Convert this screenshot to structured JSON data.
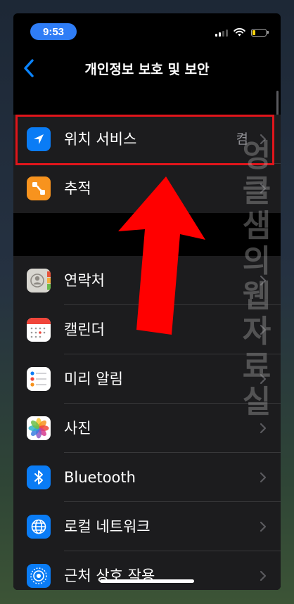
{
  "status": {
    "time": "9:53",
    "battery_level": 0.18,
    "battery_color": "#ffd60a"
  },
  "nav": {
    "back_icon": "chevron-left-icon",
    "title": "개인정보 보호 및 보안"
  },
  "group1": [
    {
      "label": "위치 서비스",
      "value": "켬",
      "icon": "location-arrow-icon",
      "icon_color": "#0a7cf5"
    },
    {
      "label": "추적",
      "icon": "tracking-icon",
      "icon_color": "#f7931e"
    }
  ],
  "group2": [
    {
      "label": "연락처",
      "icon": "contacts-icon"
    },
    {
      "label": "캘린더",
      "icon": "calendar-icon"
    },
    {
      "label": "미리 알림",
      "icon": "reminders-icon"
    },
    {
      "label": "사진",
      "icon": "photos-icon"
    },
    {
      "label": "Bluetooth",
      "icon": "bluetooth-icon",
      "icon_color": "#0a7cf5"
    },
    {
      "label": "로컬 네트워크",
      "icon": "globe-network-icon",
      "icon_color": "#0a7cf5"
    },
    {
      "label": "근처 상호 작용",
      "icon": "nearby-interaction-icon",
      "icon_color": "#0a7cf5"
    }
  ],
  "watermark": [
    "엉",
    "클",
    "샘",
    "의",
    "웹",
    "자",
    "료",
    "실"
  ],
  "accent": "#0a84ff",
  "highlight_color": "#e0151b"
}
